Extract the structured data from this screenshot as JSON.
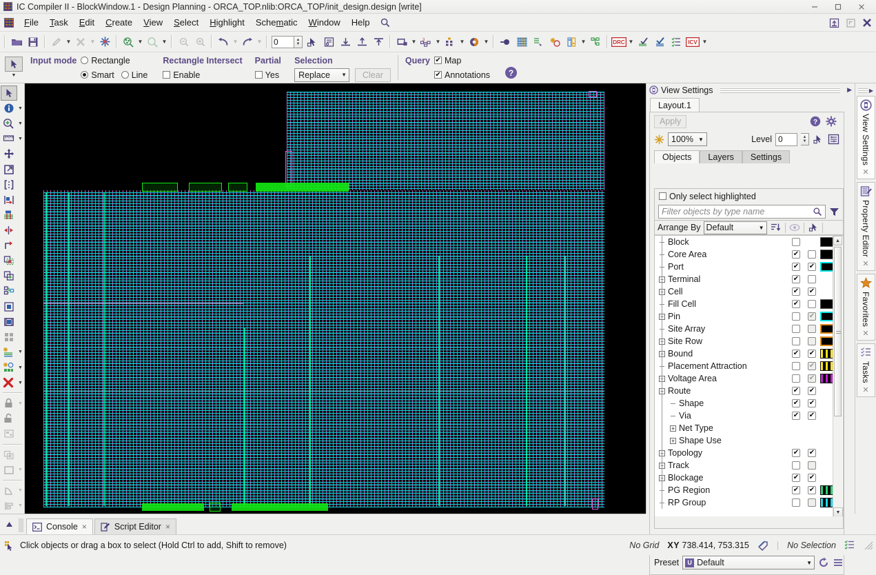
{
  "window": {
    "title": "IC Compiler II - BlockWindow.1 - Design Planning - ORCA_TOP.nlib:ORCA_TOP/init_design.design [write]",
    "minimize": "minimize-button",
    "maximize": "maximize-button",
    "close": "close-button"
  },
  "menubar": {
    "items": [
      {
        "label": "File"
      },
      {
        "label": "Task"
      },
      {
        "label": "Edit"
      },
      {
        "label": "Create"
      },
      {
        "label": "View"
      },
      {
        "label": "Select"
      },
      {
        "label": "Highlight"
      },
      {
        "label": "Schematic"
      },
      {
        "label": "Window"
      },
      {
        "label": "Help"
      }
    ],
    "search_icon": "search-icon",
    "right_icons": [
      "restore-window-icon",
      "undock-window-icon",
      "close-window-icon"
    ]
  },
  "toolbar": {
    "level_value": "0",
    "icons": [
      "open-folder-icon",
      "save-icon",
      "edit-pencil-icon",
      "cut-shape-icon",
      "snapshot-icon",
      "zoom-selection-icon",
      "zoom-area-icon",
      "previous-view-icon",
      "next-view-icon",
      "undo-icon",
      "redo-icon",
      "pointer-select-icon",
      "edit-attributes-icon",
      "align-bottom-icon",
      "align-top-icon",
      "align-middle-icon",
      "window-layout-icon",
      "bus-route-icon",
      "placement-icon",
      "color-fill-icon",
      "connect-icon",
      "grid-icon",
      "route-guide-icon",
      "optimize-icon",
      "power-plan-icon",
      "hierarchy-icon",
      "drc-icon",
      "check-layout-icon",
      "verify-icon",
      "checklist-icon",
      "icv-icon"
    ]
  },
  "options_bar": {
    "tool_icon": "arrow-select-icon",
    "input_mode": {
      "label": "Input mode",
      "options": [
        "Rectangle",
        "Smart",
        "Line"
      ],
      "selected": "Smart"
    },
    "rectangle_intersect": {
      "label": "Rectangle Intersect",
      "enable_label": "Enable",
      "enable_checked": false
    },
    "partial": {
      "label": "Partial",
      "yes_label": "Yes",
      "yes_checked": false
    },
    "selection": {
      "label": "Selection",
      "mode": "Replace",
      "clear_label": "Clear",
      "clear_enabled": false
    },
    "query": {
      "label": "Query",
      "map_label": "Map",
      "map_checked": true,
      "annotations_label": "Annotations",
      "annotations_checked": true
    },
    "help_icon": "help-icon"
  },
  "left_toolbar": {
    "icons": [
      {
        "name": "select-arrow-icon",
        "selected": true,
        "arrow": false
      },
      {
        "name": "info-icon",
        "selected": false,
        "arrow": true
      },
      {
        "name": "zoom-in-icon",
        "selected": false,
        "arrow": true
      },
      {
        "name": "ruler-icon",
        "selected": false,
        "arrow": true
      },
      {
        "name": "move-icon",
        "selected": false,
        "arrow": false
      },
      {
        "name": "resize-icon",
        "selected": false,
        "arrow": false
      },
      {
        "name": "bracket-select-icon",
        "selected": false,
        "arrow": false
      },
      {
        "name": "push-right-icon",
        "selected": false,
        "arrow": false
      },
      {
        "name": "place-cell-icon",
        "selected": false,
        "arrow": false
      },
      {
        "name": "flip-horizontal-icon",
        "selected": false,
        "arrow": false
      },
      {
        "name": "rotate-icon",
        "selected": false,
        "arrow": false
      },
      {
        "name": "delete-region-icon",
        "selected": false,
        "arrow": false
      },
      {
        "name": "copy-add-icon",
        "selected": false,
        "arrow": false
      },
      {
        "name": "connect-objects-icon",
        "selected": false,
        "arrow": false
      },
      {
        "name": "pin-guide-icon",
        "selected": false,
        "arrow": false
      },
      {
        "name": "block-view-icon",
        "selected": false,
        "arrow": false
      },
      {
        "name": "checkerboard-icon",
        "selected": false,
        "arrow": false
      },
      {
        "name": "highlight-layers-icon",
        "selected": false,
        "arrow": true
      },
      {
        "name": "highlight-search-icon",
        "selected": false,
        "arrow": true
      },
      {
        "name": "remove-highlight-icon",
        "selected": false,
        "arrow": true
      },
      {
        "name": "lock-icon",
        "selected": false,
        "arrow": true
      },
      {
        "name": "unlock-icon",
        "selected": false,
        "arrow": false
      },
      {
        "name": "edit-cell-icon",
        "selected": false,
        "arrow": false
      },
      {
        "name": "clear-selection-icon",
        "selected": false,
        "arrow": false
      },
      {
        "name": "rectangle-icon",
        "selected": false,
        "arrow": true
      },
      {
        "name": "polygon-icon",
        "selected": false,
        "arrow": true
      },
      {
        "name": "align-left-icon",
        "selected": false,
        "arrow": true
      }
    ]
  },
  "view_settings": {
    "panel_title": "View Settings",
    "panel_icon": "view-settings-icon",
    "expand_icon": "expand-arrow-icon",
    "layout_tab": "Layout.1",
    "apply_label": "Apply",
    "help_icon": "help-icon",
    "gear_icon": "gear-icon",
    "brightness_icon": "brightness-icon",
    "zoom_value": "100%",
    "level_label": "Level",
    "level_value": "0",
    "pointer_icon": "pointer-tool-icon",
    "settings_list_icon": "list-settings-icon",
    "tabs": [
      {
        "label": "Objects",
        "active": true
      },
      {
        "label": "Layers",
        "active": false
      },
      {
        "label": "Settings",
        "active": false
      }
    ],
    "only_select_highlighted": {
      "label": "Only select highlighted",
      "checked": false
    },
    "filter_placeholder": "Filter objects by type name",
    "filter_search_icon": "search-icon",
    "filter_funnel_icon": "filter-funnel-icon",
    "arrange_by": {
      "label": "Arrange By",
      "value": "Default",
      "sort_icon": "sort-descending-icon",
      "visibility_icon": "visibility-icon",
      "selectability_icon": "selectability-icon"
    },
    "preset": {
      "label": "Preset",
      "badge": "U",
      "value": "Default",
      "reload_icon": "reload-icon",
      "menu_icon": "menu-icon"
    },
    "objects": [
      {
        "name": "Block",
        "indent": 1,
        "expander": "dash",
        "visible": false,
        "selectable": null,
        "swatch": "#000000",
        "border": "#555555",
        "pattern": "solid"
      },
      {
        "name": "Core Area",
        "indent": 1,
        "expander": "dash",
        "visible": true,
        "selectable": false,
        "swatch": "#000000",
        "border": "#555555",
        "pattern": "solid"
      },
      {
        "name": "Port",
        "indent": 1,
        "expander": "dash",
        "visible": true,
        "selectable": true,
        "swatch": "#000000",
        "border": "#00e5e5",
        "pattern": "solid"
      },
      {
        "name": "Terminal",
        "indent": 1,
        "expander": "plus",
        "visible": true,
        "selectable": false,
        "swatch": null,
        "border": null,
        "pattern": "none"
      },
      {
        "name": "Cell",
        "indent": 1,
        "expander": "plus",
        "visible": true,
        "selectable": true,
        "swatch": null,
        "border": null,
        "pattern": "none"
      },
      {
        "name": "Fill Cell",
        "indent": 1,
        "expander": "dash",
        "visible": true,
        "selectable": false,
        "swatch": "#000000",
        "border": "#555555",
        "pattern": "solid"
      },
      {
        "name": "Pin",
        "indent": 1,
        "expander": "plus",
        "visible": false,
        "selectable": "grey",
        "swatch": "#000000",
        "border": "#00e5e5",
        "pattern": "solid"
      },
      {
        "name": "Site Array",
        "indent": 1,
        "expander": "dash",
        "visible": false,
        "selectable": "off",
        "swatch": "#000000",
        "border": "#e08a1e",
        "pattern": "solid"
      },
      {
        "name": "Site Row",
        "indent": 1,
        "expander": "plus",
        "visible": false,
        "selectable": "off",
        "swatch": "#000000",
        "border": "#e08a1e",
        "pattern": "solid"
      },
      {
        "name": "Bound",
        "indent": 1,
        "expander": "plus",
        "visible": true,
        "selectable": true,
        "swatch": "#000000",
        "border": "#111111",
        "pattern": "yellow"
      },
      {
        "name": "Placement Attraction",
        "indent": 1,
        "expander": "dash",
        "visible": false,
        "selectable": "grey",
        "swatch": "#000000",
        "border": "#111111",
        "pattern": "yellow"
      },
      {
        "name": "Voltage Area",
        "indent": 1,
        "expander": "plus",
        "visible": false,
        "selectable": "grey",
        "swatch": "#000000",
        "border": "#111111",
        "pattern": "magenta"
      },
      {
        "name": "Route",
        "indent": 1,
        "expander": "minus",
        "visible": true,
        "selectable": true,
        "swatch": null,
        "border": null,
        "pattern": "none"
      },
      {
        "name": "Shape",
        "indent": 2,
        "expander": "dash",
        "visible": true,
        "selectable": true,
        "swatch": null,
        "border": null,
        "pattern": "none"
      },
      {
        "name": "Via",
        "indent": 2,
        "expander": "dash",
        "visible": true,
        "selectable": true,
        "swatch": null,
        "border": null,
        "pattern": "none"
      },
      {
        "name": "Net Type",
        "indent": 2,
        "expander": "plus",
        "visible": null,
        "selectable": null,
        "swatch": null,
        "border": null,
        "pattern": "none"
      },
      {
        "name": "Shape Use",
        "indent": 2,
        "expander": "plus",
        "visible": null,
        "selectable": null,
        "swatch": null,
        "border": null,
        "pattern": "none"
      },
      {
        "name": "Topology",
        "indent": 1,
        "expander": "plus",
        "visible": true,
        "selectable": true,
        "swatch": null,
        "border": null,
        "pattern": "none"
      },
      {
        "name": "Track",
        "indent": 1,
        "expander": "plus",
        "visible": false,
        "selectable": "off",
        "swatch": null,
        "border": null,
        "pattern": "none"
      },
      {
        "name": "Blockage",
        "indent": 1,
        "expander": "plus",
        "visible": true,
        "selectable": true,
        "swatch": null,
        "border": null,
        "pattern": "none"
      },
      {
        "name": "PG Region",
        "indent": 1,
        "expander": "dash",
        "visible": true,
        "selectable": true,
        "swatch": "#000000",
        "border": "#111111",
        "pattern": "green"
      },
      {
        "name": "RP Group",
        "indent": 1,
        "expander": "dash",
        "visible": false,
        "selectable": "off",
        "swatch": "#000000",
        "border": "#111111",
        "pattern": "cyan"
      }
    ]
  },
  "right_tabs": [
    {
      "label": "View Settings",
      "icon": "view-settings-icon",
      "selected": true
    },
    {
      "label": "Property Editor",
      "icon": "property-editor-icon",
      "selected": false
    },
    {
      "label": "Favorites",
      "icon": "star-icon",
      "selected": false
    },
    {
      "label": "Tasks",
      "icon": "tasks-icon",
      "selected": false
    }
  ],
  "bottom_tabs": [
    {
      "label": "Console",
      "icon": "console-icon",
      "active": true,
      "close": "×"
    },
    {
      "label": "Script Editor",
      "icon": "script-editor-icon",
      "active": false,
      "close": "×"
    }
  ],
  "status_bar": {
    "icon": "select-objects-icon",
    "message": "Click objects or drag a box to select (Hold Ctrl to add, Shift to remove)",
    "grid": "No Grid",
    "xy_label": "XY",
    "xy_value": "738.414, 753.315",
    "snap_icon": "snap-icon",
    "selection": "No Selection",
    "list_icon": "selection-list-icon"
  }
}
